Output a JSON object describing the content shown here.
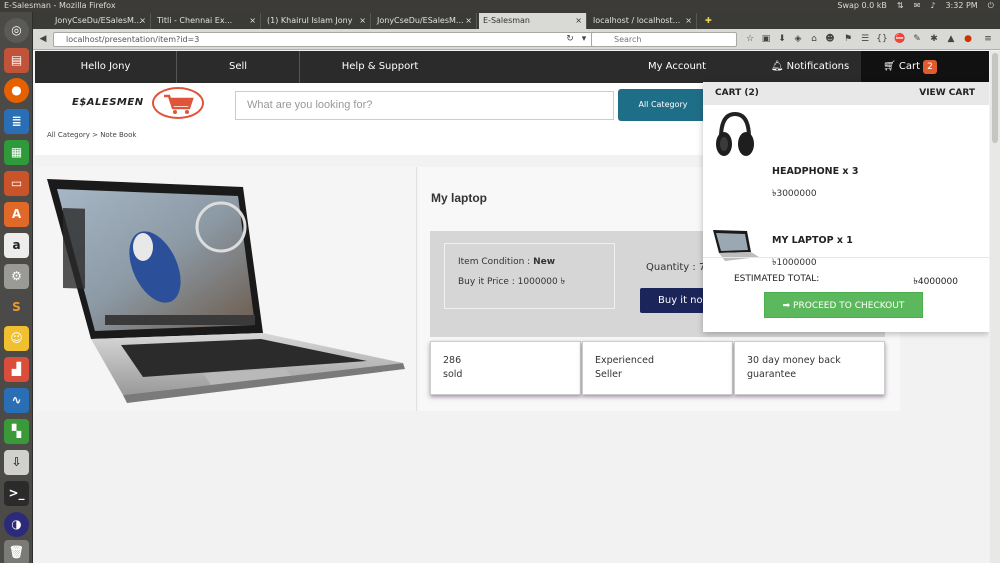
{
  "os": {
    "title": "E-Salesman - Mozilla Firefox",
    "swap": "Swap 0.0 kB",
    "time": "3:32 PM"
  },
  "tabs": [
    {
      "label": "JonyCseDu/ESalesM...",
      "active": false
    },
    {
      "label": "Titli - Chennai Ex...",
      "active": false
    },
    {
      "label": "(1) Khairul Islam Jony",
      "active": false
    },
    {
      "label": "JonyCseDu/ESalesM...",
      "active": false
    },
    {
      "label": "E-Salesman",
      "active": true
    },
    {
      "label": "localhost / localhost...",
      "active": false
    }
  ],
  "browser": {
    "url": "localhost/presentation/item?id=3",
    "search_placeholder": "Search"
  },
  "site_nav": {
    "hello": "Hello Jony",
    "sell": "Sell",
    "help": "Help & Support",
    "account": "My Account",
    "notifications": "Notifications",
    "cart": "Cart",
    "cart_count": "2"
  },
  "header": {
    "logo": "E$ALESMEN",
    "search_placeholder": "What are you looking for?",
    "category_button": "All Category"
  },
  "breadcrumb": "All Category > Note Book",
  "product": {
    "title": "My laptop",
    "condition_label": "Item Condition : ",
    "condition_value": "New",
    "price_label": "Buy it Price : ",
    "price_value": "1000000 ৳",
    "quantity_label": "Quantity : 7",
    "buy_button": "Buy it now",
    "features": [
      {
        "line1": "286",
        "line2": "sold"
      },
      {
        "line1": "Experienced",
        "line2": "Seller"
      },
      {
        "line1": "30 day money back",
        "line2": "guarantee"
      }
    ]
  },
  "cart_dropdown": {
    "title": "CART (2)",
    "view_cart": "VIEW CART",
    "items": [
      {
        "name": "HEADPHONE x 3",
        "price": "৳3000000"
      },
      {
        "name": "MY LAPTOP x 1",
        "price": "৳1000000"
      }
    ],
    "estimated_label": "ESTIMATED TOTAL:",
    "estimated_value": "৳4000000",
    "checkout": "➡ PROCEED TO CHECKOUT"
  },
  "colors": {
    "nav_bg": "#2b2b2b",
    "cart_badge": "#e05c2e",
    "buy_button": "#1b255a",
    "checkout": "#5cb85c",
    "category_button": "#1f6e87"
  }
}
